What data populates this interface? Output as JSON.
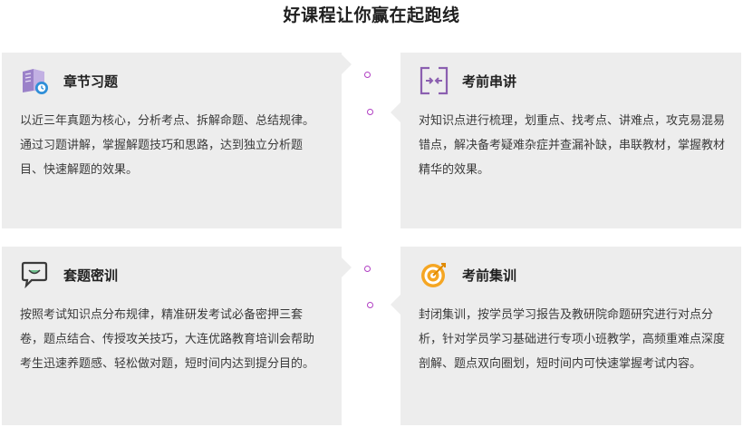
{
  "page": {
    "title": "好课程让你赢在起跑线"
  },
  "cards": [
    {
      "title": "章节习题",
      "icon": "open-book-clock-icon",
      "body": "以近三年真题为核心，分析考点、拆解命题、总结规律。通过习题讲解，掌握解题技巧和思路，达到独立分析题目、快速解题的效果。"
    },
    {
      "title": "考前串讲",
      "icon": "merge-arrows-icon",
      "body": "对知识点进行梳理，划重点、找考点、讲难点，攻克易混易错点，解决备考疑难杂症并查漏补缺，串联教材，掌握教材精华的效果。"
    },
    {
      "title": "套题密训",
      "icon": "chat-bubble-icon",
      "body": "按照考试知识点分布规律，精准研发考试必备密押三套卷，题点结合、传授攻关技巧，大连优路教育培训会帮助考生迅速养题感、轻松做对题，短时间内达到提分目的。"
    },
    {
      "title": "考前集训",
      "icon": "target-icon",
      "body": "封闭集训，按学员学习报告及教研院命题研究进行对点分析，针对学员学习基础进行专项小班教学，高频重难点深度剖解、题点双向圈划，短时间内可快速掌握考试内容。"
    }
  ],
  "colors": {
    "card_bg": "#ededed",
    "accent_purple": "#8b5fb0",
    "accent_orange": "#f5a623",
    "dot": "#b13fc3"
  }
}
